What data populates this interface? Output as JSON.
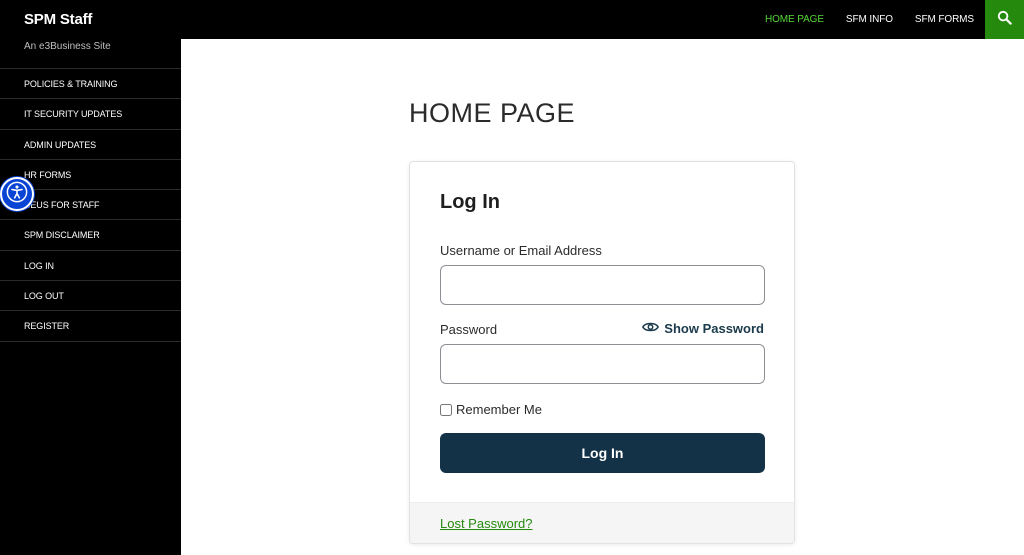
{
  "site": {
    "title": "SPM Staff",
    "tagline": "An e3Business Site"
  },
  "topnav": [
    {
      "label": "HOME PAGE",
      "active": true
    },
    {
      "label": "SFM INFO",
      "active": false
    },
    {
      "label": "SFM FORMS",
      "active": false
    }
  ],
  "search": {
    "icon": "search-icon"
  },
  "sidebar": {
    "items": [
      {
        "label": "POLICIES & TRAINING"
      },
      {
        "label": "IT SECURITY UPDATES"
      },
      {
        "label": "ADMIN UPDATES"
      },
      {
        "label": "HR FORMS"
      },
      {
        "label": "CEUS FOR STAFF"
      },
      {
        "label": "SPM DISCLAIMER"
      },
      {
        "label": "LOG IN"
      },
      {
        "label": "LOG OUT"
      },
      {
        "label": "REGISTER"
      }
    ]
  },
  "accessibility": {
    "icon": "accessibility-icon"
  },
  "main": {
    "page_title": "HOME PAGE"
  },
  "login": {
    "title": "Log In",
    "username_label": "Username or Email Address",
    "username_value": "",
    "password_label": "Password",
    "password_value": "",
    "show_password_label": "Show Password",
    "remember_label": "Remember Me",
    "remember_checked": false,
    "submit_label": "Log In",
    "lost_password_label": "Lost Password?"
  },
  "colors": {
    "topbar_bg": "#000000",
    "accent_green": "#24890d",
    "active_nav": "#55d737",
    "button_bg": "#143247",
    "a11y_blue": "#0a44d4"
  }
}
